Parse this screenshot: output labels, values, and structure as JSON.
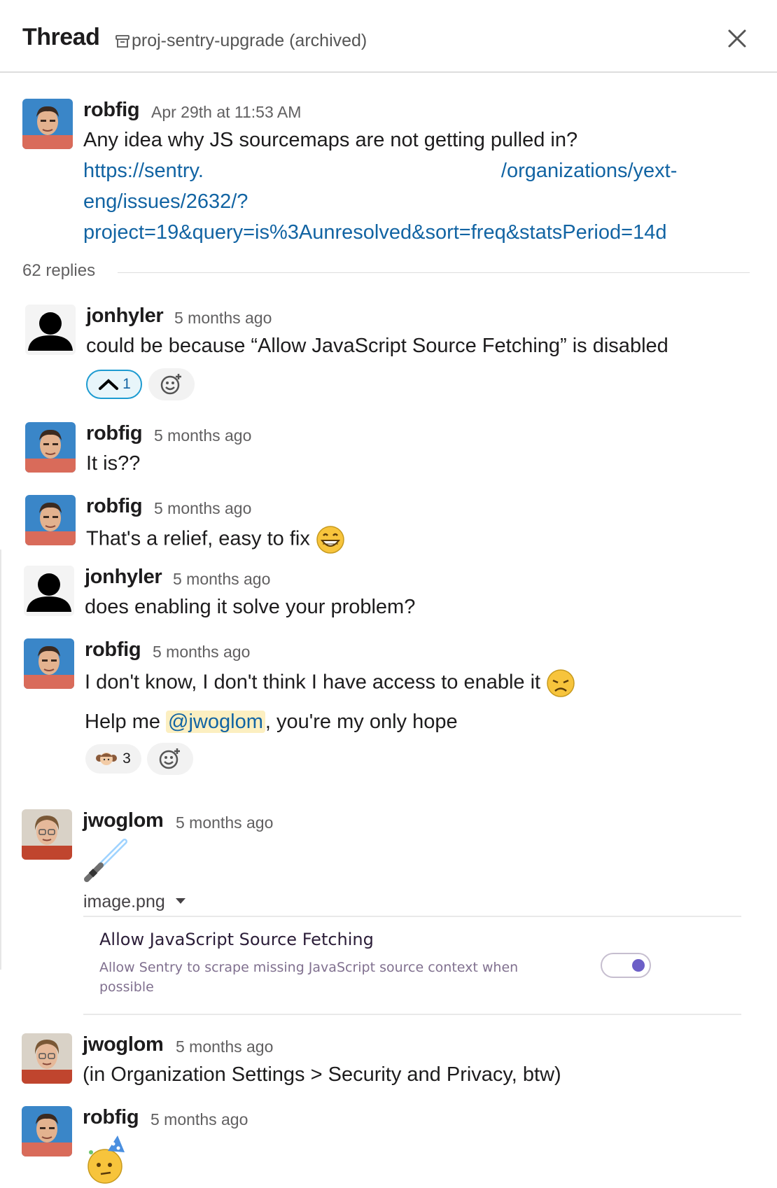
{
  "header": {
    "title": "Thread",
    "channel": "proj-sentry-upgrade (archived)"
  },
  "parent": {
    "user": "robfig",
    "time": "Apr 29th at 11:53 AM",
    "text": "Any idea why JS sourcemaps are not getting pulled in?",
    "link_line1_a": "https://sentry.",
    "link_line1_b": "/organizations/yext-",
    "link_line2": "eng/issues/2632/?",
    "link_line3": "project=19&query=is%3Aunresolved&sort=freq&statsPeriod=14d"
  },
  "replies_label": "62 replies",
  "messages": [
    {
      "user": "jonhyler",
      "time": "5 months ago",
      "text": "could be because “Allow JavaScript Source Fetching” is disabled",
      "reaction_count": "1"
    },
    {
      "user": "robfig",
      "time": "5 months ago",
      "text": "It is??"
    },
    {
      "user": "robfig",
      "time": "5 months ago",
      "text": "That's a relief, easy to fix"
    },
    {
      "user": "jonhyler",
      "time": "5 months ago",
      "text": "does enabling it solve your problem?"
    },
    {
      "user": "robfig",
      "time": "5 months ago",
      "text": "I don't know, I don't think I have access to enable it",
      "text2_a": "Help me ",
      "mention": "@jwoglom",
      "text2_b": ", you're my only hope",
      "reaction_count": "3"
    },
    {
      "user": "jwoglom",
      "time": "5 months ago",
      "file_name": "image.png"
    },
    {
      "user": "jwoglom",
      "time": "5 months ago",
      "text": "(in Organization Settings > Security and Privacy, btw)"
    },
    {
      "user": "robfig",
      "time": "5 months ago"
    }
  ],
  "preview": {
    "title": "Allow JavaScript Source Fetching",
    "description": "Allow Sentry to scrape missing JavaScript source context when possible",
    "toggle_on": true
  },
  "icons": [
    "archive-icon",
    "close-icon",
    "upvote-emoji",
    "add-reaction-icon",
    "grin-emoji",
    "disappointed-emoji",
    "princess-leia-emoji",
    "lightsaber-emoji",
    "party-face-emoji",
    "dropdown-caret-icon"
  ],
  "colors": {
    "link": "#1264a3",
    "mention_bg": "#fcefc1",
    "reaction_active": "#1d9bd1",
    "toggle_knob": "#6c5fc7"
  }
}
